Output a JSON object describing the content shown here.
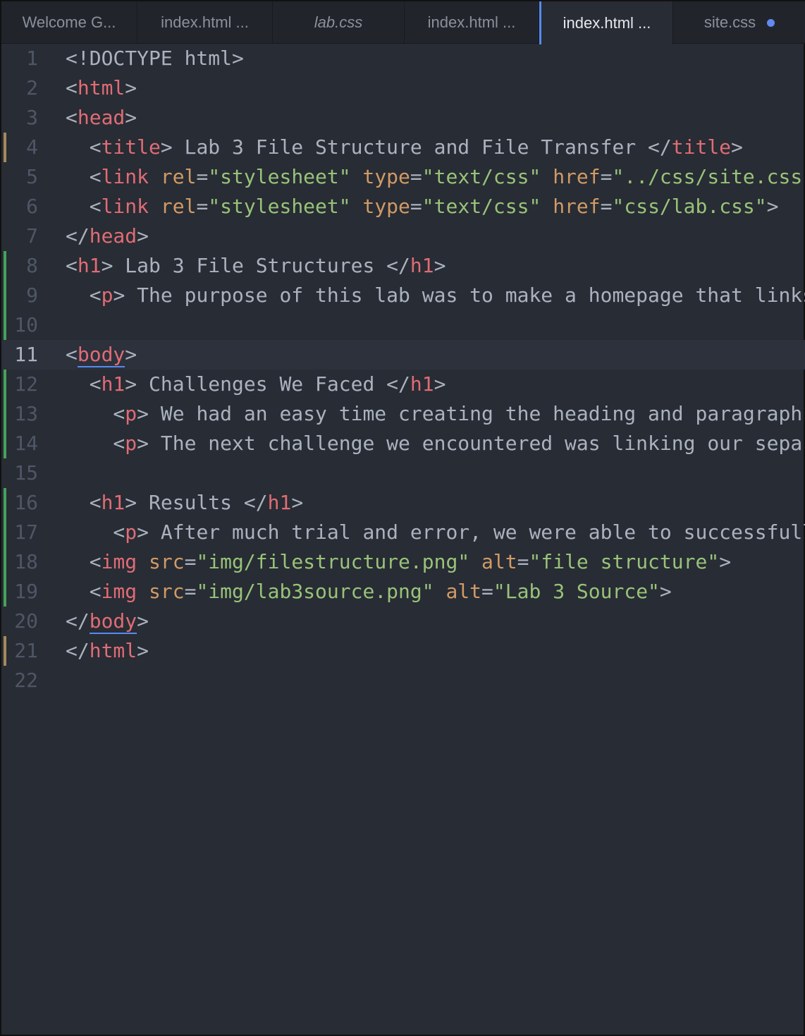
{
  "tabs": [
    {
      "label": "Welcome G...",
      "width": 193,
      "style": "normal"
    },
    {
      "label": "index.html ...",
      "width": 192,
      "style": "normal"
    },
    {
      "label": "lab.css",
      "width": 187,
      "style": "italic"
    },
    {
      "label": "index.html ...",
      "width": 191,
      "style": "normal"
    },
    {
      "label": "index.html ...",
      "width": 190,
      "style": "active"
    },
    {
      "label": "site.css",
      "width": 189,
      "style": "modified"
    }
  ],
  "colors": {
    "tag": "#e06c75",
    "attr": "#d19a66",
    "string": "#98c379",
    "text": "#abb2bf",
    "accent": "#568af2"
  },
  "lines": [
    {
      "n": "1",
      "git": "",
      "tokens": [
        [
          "p",
          "<!DOCTYPE html>"
        ]
      ]
    },
    {
      "n": "2",
      "git": "",
      "tokens": [
        [
          "p",
          "<"
        ],
        [
          "tag",
          "html"
        ],
        [
          "p",
          ">"
        ]
      ]
    },
    {
      "n": "3",
      "git": "",
      "tokens": [
        [
          "p",
          "<"
        ],
        [
          "tag",
          "head"
        ],
        [
          "p",
          ">"
        ]
      ]
    },
    {
      "n": "4",
      "git": "modified",
      "tokens": [
        [
          "p",
          "  <"
        ],
        [
          "tag",
          "title"
        ],
        [
          "p",
          "> Lab 3 File Structure and File Transfer </"
        ],
        [
          "tag",
          "title"
        ],
        [
          "p",
          ">"
        ]
      ]
    },
    {
      "n": "5",
      "git": "",
      "tokens": [
        [
          "p",
          "  <"
        ],
        [
          "tag",
          "link"
        ],
        [
          "p",
          " "
        ],
        [
          "attr",
          "rel"
        ],
        [
          "p",
          "="
        ],
        [
          "str",
          "\"stylesheet\""
        ],
        [
          "p",
          " "
        ],
        [
          "attr",
          "type"
        ],
        [
          "p",
          "="
        ],
        [
          "str",
          "\"text/css\""
        ],
        [
          "p",
          " "
        ],
        [
          "attr",
          "href"
        ],
        [
          "p",
          "="
        ],
        [
          "str",
          "\"../css/site.css\""
        ]
      ]
    },
    {
      "n": "6",
      "git": "",
      "tokens": [
        [
          "p",
          "  <"
        ],
        [
          "tag",
          "link"
        ],
        [
          "p",
          " "
        ],
        [
          "attr",
          "rel"
        ],
        [
          "p",
          "="
        ],
        [
          "str",
          "\"stylesheet\""
        ],
        [
          "p",
          " "
        ],
        [
          "attr",
          "type"
        ],
        [
          "p",
          "="
        ],
        [
          "str",
          "\"text/css\""
        ],
        [
          "p",
          " "
        ],
        [
          "attr",
          "href"
        ],
        [
          "p",
          "="
        ],
        [
          "str",
          "\"css/lab.css\""
        ],
        [
          "p",
          ">"
        ]
      ]
    },
    {
      "n": "7",
      "git": "",
      "tokens": [
        [
          "p",
          "</"
        ],
        [
          "tag",
          "head"
        ],
        [
          "p",
          ">"
        ]
      ]
    },
    {
      "n": "8",
      "git": "added",
      "tokens": [
        [
          "p",
          "<"
        ],
        [
          "tag",
          "h1"
        ],
        [
          "p",
          "> Lab 3 File Structures </"
        ],
        [
          "tag",
          "h1"
        ],
        [
          "p",
          ">"
        ]
      ]
    },
    {
      "n": "9",
      "git": "added",
      "tokens": [
        [
          "p",
          "  <"
        ],
        [
          "tag",
          "p"
        ],
        [
          "p",
          "> The purpose of this lab was to make a homepage that links"
        ]
      ]
    },
    {
      "n": "10",
      "git": "added",
      "tokens": []
    },
    {
      "n": "11",
      "git": "",
      "current": true,
      "tokens": [
        [
          "p",
          "<"
        ],
        [
          "tagu",
          "body"
        ],
        [
          "p",
          ">"
        ]
      ]
    },
    {
      "n": "12",
      "git": "added",
      "tokens": [
        [
          "p",
          "  <"
        ],
        [
          "tag",
          "h1"
        ],
        [
          "p",
          "> Challenges We Faced </"
        ],
        [
          "tag",
          "h1"
        ],
        [
          "p",
          ">"
        ]
      ]
    },
    {
      "n": "13",
      "git": "added",
      "tokens": [
        [
          "p",
          "    <"
        ],
        [
          "tag",
          "p"
        ],
        [
          "p",
          "> We had an easy time creating the heading and paragraph"
        ]
      ]
    },
    {
      "n": "14",
      "git": "added",
      "tokens": [
        [
          "p",
          "    <"
        ],
        [
          "tag",
          "p"
        ],
        [
          "p",
          "> The next challenge we encountered was linking our sepa"
        ]
      ]
    },
    {
      "n": "15",
      "git": "",
      "tokens": []
    },
    {
      "n": "16",
      "git": "added",
      "tokens": [
        [
          "p",
          "  <"
        ],
        [
          "tag",
          "h1"
        ],
        [
          "p",
          "> Results </"
        ],
        [
          "tag",
          "h1"
        ],
        [
          "p",
          ">"
        ]
      ]
    },
    {
      "n": "17",
      "git": "added",
      "tokens": [
        [
          "p",
          "    <"
        ],
        [
          "tag",
          "p"
        ],
        [
          "p",
          "> After much trial and error, we were able to successfull"
        ]
      ]
    },
    {
      "n": "18",
      "git": "added",
      "tokens": [
        [
          "p",
          "  <"
        ],
        [
          "tag",
          "img"
        ],
        [
          "p",
          " "
        ],
        [
          "attr",
          "src"
        ],
        [
          "p",
          "="
        ],
        [
          "str",
          "\"img/filestructure.png\""
        ],
        [
          "p",
          " "
        ],
        [
          "attr",
          "alt"
        ],
        [
          "p",
          "="
        ],
        [
          "str",
          "\"file structure\""
        ],
        [
          "p",
          ">"
        ]
      ]
    },
    {
      "n": "19",
      "git": "added",
      "tokens": [
        [
          "p",
          "  <"
        ],
        [
          "tag",
          "img"
        ],
        [
          "p",
          " "
        ],
        [
          "attr",
          "src"
        ],
        [
          "p",
          "="
        ],
        [
          "str",
          "\"img/lab3source.png\""
        ],
        [
          "p",
          " "
        ],
        [
          "attr",
          "alt"
        ],
        [
          "p",
          "="
        ],
        [
          "str",
          "\"Lab 3 Source\""
        ],
        [
          "p",
          ">"
        ]
      ]
    },
    {
      "n": "20",
      "git": "",
      "tokens": [
        [
          "p",
          "</"
        ],
        [
          "tagu",
          "body"
        ],
        [
          "p",
          ">"
        ]
      ]
    },
    {
      "n": "21",
      "git": "modified",
      "tokens": [
        [
          "p",
          "</"
        ],
        [
          "tag",
          "html"
        ],
        [
          "p",
          ">"
        ]
      ]
    },
    {
      "n": "22",
      "git": "",
      "tokens": []
    }
  ]
}
